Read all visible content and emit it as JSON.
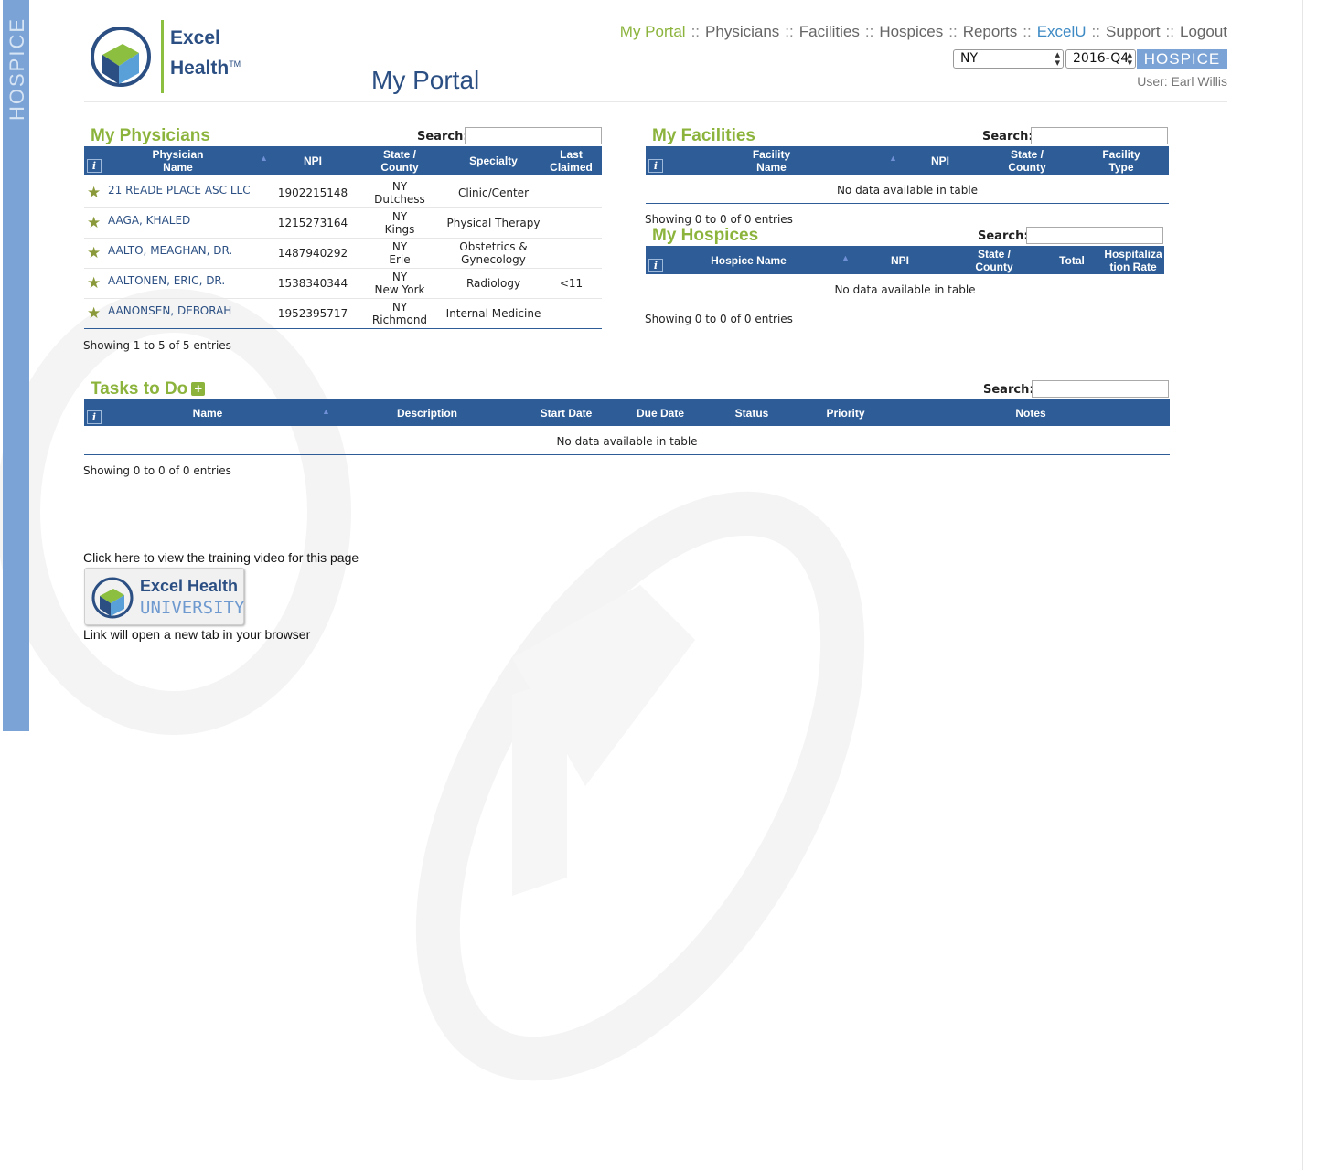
{
  "sidebar": {
    "vertical_label": "HOSPICE"
  },
  "logo": {
    "brand_line1": "Excel",
    "brand_line2": "Health",
    "tm": "TM"
  },
  "page_title": "My Portal",
  "nav": {
    "items": [
      "My Portal",
      "Physicians",
      "Facilities",
      "Hospices",
      "Reports",
      "ExcelU",
      "Support",
      "Logout"
    ],
    "separator": "::"
  },
  "selectors": {
    "state": "NY",
    "quarter": "2016-Q4",
    "badge": "HOSPICE"
  },
  "user": {
    "label": "User: Earl Willis"
  },
  "physicians": {
    "title": "My Physicians",
    "search_label": "Search:",
    "columns": [
      "Physician Name",
      "NPI",
      "State / County",
      "Specialty",
      "Last Claimed"
    ],
    "rows": [
      {
        "name": "21 READE PLACE ASC LLC",
        "npi": "1902215148",
        "state": "NY",
        "county": "Dutchess",
        "specialty": "Clinic/Center",
        "last": ""
      },
      {
        "name": "AAGA, KHALED",
        "npi": "1215273164",
        "state": "NY",
        "county": "Kings",
        "specialty": "Physical Therapy",
        "last": ""
      },
      {
        "name": "AALTO, MEAGHAN, DR.",
        "npi": "1487940292",
        "state": "NY",
        "county": "Erie",
        "specialty": "Obstetrics & Gynecology",
        "last": ""
      },
      {
        "name": "AALTONEN, ERIC, DR.",
        "npi": "1538340344",
        "state": "NY",
        "county": "New York",
        "specialty": "Radiology",
        "last": "<11"
      },
      {
        "name": "AANONSEN, DEBORAH",
        "npi": "1952395717",
        "state": "NY",
        "county": "Richmond",
        "specialty": "Internal Medicine",
        "last": ""
      }
    ],
    "info": "Showing 1 to 5 of 5 entries"
  },
  "facilities": {
    "title": "My Facilities",
    "search_label": "Search:",
    "columns": [
      "Facility Name",
      "NPI",
      "State / County",
      "Facility Type"
    ],
    "empty": "No data available in table",
    "info": "Showing 0 to 0 of 0 entries"
  },
  "hospices": {
    "title": "My Hospices",
    "search_label": "Search:",
    "columns": [
      "Hospice Name",
      "NPI",
      "State / County",
      "Total",
      "Hospitalization Rate"
    ],
    "empty": "No data available in table",
    "info": "Showing 0 to 0 of 0 entries"
  },
  "tasks": {
    "title": "Tasks to Do",
    "search_label": "Search:",
    "columns": [
      "Name",
      "Description",
      "Start Date",
      "Due Date",
      "Status",
      "Priority",
      "Notes"
    ],
    "empty": "No data available in table",
    "info": "Showing 0 to 0 of 0 entries"
  },
  "training": {
    "text": "Click here to view the training video for this page",
    "badge_line1": "Excel Health",
    "badge_line2": "UNIVERSITY",
    "note": "Link will open a new tab in your browser"
  },
  "colors": {
    "accent_green": "#8cb43d",
    "header_blue": "#2d5c96",
    "brand_navy": "#2b4f83",
    "sidebar_blue": "#7ba3d6"
  }
}
